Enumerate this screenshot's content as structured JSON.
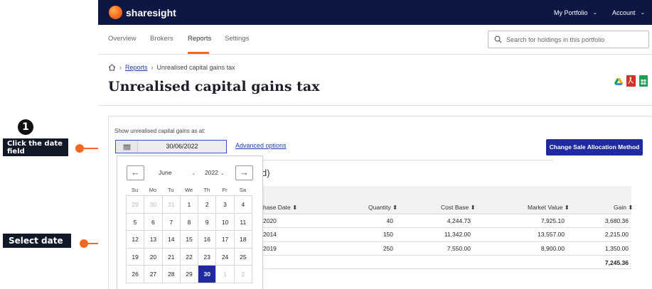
{
  "annotations": {
    "step_number": "1",
    "callout_click": "Click the date field",
    "callout_select": "Select date",
    "accent_color": "#f26a21"
  },
  "topbar": {
    "brand": "sharesight",
    "my_portfolio": "My Portfolio",
    "account": "Account"
  },
  "tabs": [
    "Overview",
    "Brokers",
    "Reports",
    "Settings"
  ],
  "search": {
    "placeholder": "Search for holdings in this portfolio"
  },
  "breadcrumb": {
    "reports": "Reports",
    "current": "Unrealised capital gains tax"
  },
  "page_title": "Unrealised capital gains tax",
  "filter": {
    "label": "Show unrealised capital gains as at:",
    "date_value": "30/06/2022",
    "advanced_options": "Advanced options",
    "allocation_button": "Change Sale Allocation Method"
  },
  "section_heading_fragment": "d)",
  "table": {
    "headers": [
      "hase Date ⬍",
      "Quantity ⬍",
      "Cost Base ⬍",
      "Market Value ⬍",
      "Gain ⬍"
    ],
    "rows": [
      [
        "2020",
        "40",
        "4,244.73",
        "7,925.10",
        "3,680.36"
      ],
      [
        "2014",
        "150",
        "11,342.00",
        "13,557.00",
        "2,215.00"
      ],
      [
        "2019",
        "250",
        "7,550.00",
        "8,900.00",
        "1,350.00"
      ]
    ],
    "total_gain": "7,245.36"
  },
  "calendar": {
    "month": "June",
    "year": "2022",
    "weekdays": [
      "Su",
      "Mo",
      "Tu",
      "We",
      "Th",
      "Fr",
      "Sa"
    ],
    "weeks": [
      [
        "29",
        "30",
        "31",
        "1",
        "2",
        "3",
        "4"
      ],
      [
        "5",
        "6",
        "7",
        "8",
        "9",
        "10",
        "11"
      ],
      [
        "12",
        "13",
        "14",
        "15",
        "16",
        "17",
        "18"
      ],
      [
        "19",
        "20",
        "21",
        "22",
        "23",
        "24",
        "25"
      ],
      [
        "26",
        "27",
        "28",
        "29",
        "30",
        "1",
        "2"
      ]
    ],
    "selected_day": "30"
  }
}
